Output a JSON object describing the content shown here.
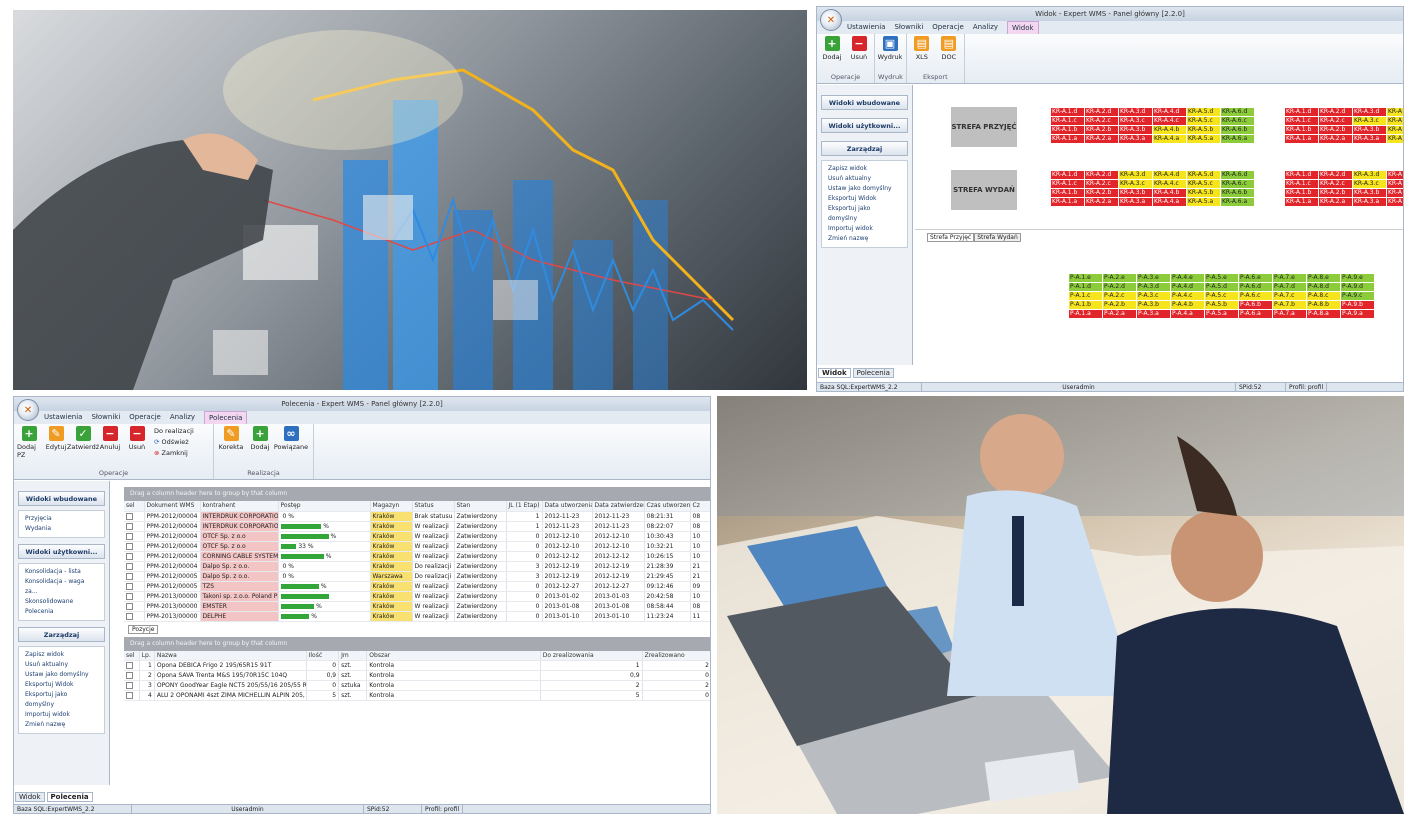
{
  "top_right": {
    "title": "Widok - Expert WMS - Panel główny [2.2.0]",
    "menu": [
      "Ustawienia",
      "Słowniki",
      "Operacje",
      "Analizy",
      "Widok"
    ],
    "ribbon": {
      "operacje": {
        "label": "Operacje",
        "buttons": [
          "Dodaj",
          "Usuń"
        ]
      },
      "wydruk": {
        "label": "Wydruk",
        "buttons": [
          "Wydruk"
        ]
      },
      "eksport": {
        "label": "Eksport",
        "buttons": [
          "XLS",
          "DOC"
        ]
      }
    },
    "sidebar": {
      "sections": [
        "Widoki wbudowane",
        "Widoki użytkowni...",
        "Zarządzaj"
      ],
      "manage": [
        "Zapisz widok",
        "Usuń aktualny",
        "Ustaw jako domyślny",
        "Eksportuj Widok",
        "Eksportuj jako domyślny",
        "Importuj widok",
        "Zmień nazwę"
      ]
    },
    "zones": [
      "STREFA PRZYJĘĆ",
      "STREFA WYDAŃ"
    ],
    "racks_a": [
      [
        "KR-A.1.d",
        "KR-A.2.d",
        "KR-A.3.d",
        "KR-A.4.d",
        "KR-A.5.d",
        "KR-A.6.d"
      ],
      [
        "KR-A.1.c",
        "KR-A.2.c",
        "KR-A.3.c",
        "KR-A.4.c",
        "KR-A.5.c",
        "KR-A.6.c"
      ],
      [
        "KR-A.1.b",
        "KR-A.2.b",
        "KR-A.3.b",
        "KR-A.4.b",
        "KR-A.5.b",
        "KR-A.6.b"
      ],
      [
        "KR-A.1.a",
        "KR-A.2.a",
        "KR-A.3.a",
        "KR-A.4.a",
        "KR-A.5.a",
        "KR-A.6.a"
      ]
    ],
    "racks_a_colors": [
      [
        "r",
        "r",
        "r",
        "r",
        "y",
        "g"
      ],
      [
        "r",
        "r",
        "r",
        "r",
        "y",
        "g"
      ],
      [
        "r",
        "r",
        "r",
        "y",
        "y",
        "g"
      ],
      [
        "r",
        "r",
        "r",
        "y",
        "y",
        "g"
      ]
    ],
    "racks_b_colors": [
      [
        "r",
        "r",
        "y",
        "y",
        "y",
        "g"
      ],
      [
        "r",
        "r",
        "y",
        "y",
        "y",
        "g"
      ],
      [
        "r",
        "r",
        "r",
        "r",
        "y",
        "g"
      ],
      [
        "r",
        "r",
        "r",
        "r",
        "y",
        "g"
      ]
    ],
    "racks_c": [
      [
        "KR-A.1.d",
        "KR-A.2.d",
        "KR-A.3.d",
        "KR-A"
      ],
      [
        "KR-A.1.c",
        "KR-A.2.c",
        "KR-A.3.c",
        "KR-A"
      ],
      [
        "KR-A.1.b",
        "KR-A.2.b",
        "KR-A.3.b",
        "KR-A"
      ],
      [
        "KR-A.1.a",
        "KR-A.2.a",
        "KR-A.3.a",
        "KR-A"
      ]
    ],
    "racks_c_colors": [
      [
        "r",
        "r",
        "r",
        "y"
      ],
      [
        "r",
        "r",
        "y",
        "y"
      ],
      [
        "r",
        "r",
        "r",
        "y"
      ],
      [
        "r",
        "r",
        "r",
        "y"
      ]
    ],
    "racks_d_colors": [
      [
        "r",
        "r",
        "y",
        "r"
      ],
      [
        "r",
        "r",
        "y",
        "r"
      ],
      [
        "r",
        "r",
        "r",
        "r"
      ],
      [
        "r",
        "r",
        "r",
        "r"
      ]
    ],
    "subtabs": [
      "Strefa Przyjęć",
      "Strefa Wydań"
    ],
    "racks_p": [
      [
        "P-A.1.e",
        "P-A.2.e",
        "P-A.3.e",
        "P-A.4.e",
        "P-A.5.e",
        "P-A.6.e",
        "P-A.7.e",
        "P-A.8.e",
        "P-A.9.e"
      ],
      [
        "P-A.1.d",
        "P-A.2.d",
        "P-A.3.d",
        "P-A.4.d",
        "P-A.5.d",
        "P-A.6.d",
        "P-A.7.d",
        "P-A.8.d",
        "P-A.9.d"
      ],
      [
        "P-A.1.c",
        "P-A.2.c",
        "P-A.3.c",
        "P-A.4.c",
        "P-A.5.c",
        "P-A.6.c",
        "P-A.7.c",
        "P-A.8.c",
        "P-A.9.c"
      ],
      [
        "P-A.1.b",
        "P-A.2.b",
        "P-A.3.b",
        "P-A.4.b",
        "P-A.5.b",
        "P-A.6.b",
        "P-A.7.b",
        "P-A.8.b",
        "P-A.9.b"
      ],
      [
        "P-A.1.a",
        "P-A.2.a",
        "P-A.3.a",
        "P-A.4.a",
        "P-A.5.a",
        "P-A.6.a",
        "P-A.7.a",
        "P-A.8.a",
        "P-A.9.a"
      ]
    ],
    "racks_p_colors": [
      [
        "g",
        "g",
        "g",
        "g",
        "g",
        "g",
        "g",
        "g",
        "g"
      ],
      [
        "g",
        "g",
        "g",
        "g",
        "g",
        "g",
        "g",
        "g",
        "g"
      ],
      [
        "y",
        "y",
        "y",
        "y",
        "y",
        "y",
        "y",
        "y",
        "g"
      ],
      [
        "y",
        "y",
        "y",
        "y",
        "y",
        "r",
        "y",
        "y",
        "r"
      ],
      [
        "r",
        "r",
        "r",
        "r",
        "r",
        "r",
        "r",
        "r",
        "r"
      ]
    ],
    "bottom_tabs": [
      "Widok",
      "Polecenia"
    ],
    "status": [
      "Baza SQL:ExpertWMS_2.2",
      "Useradmin",
      "SPid:52",
      "Profil: profil"
    ]
  },
  "bottom_left": {
    "title": "Polecenia - Expert WMS - Panel główny [2.2.0]",
    "menu": [
      "Ustawienia",
      "Słowniki",
      "Operacje",
      "Analizy",
      "Polecenia"
    ],
    "ribbon": {
      "operacje_label": "Operacje",
      "realizacja_label": "Realizacja",
      "buttons": [
        "Dodaj PZ",
        "Edytuj",
        "Zatwierdź",
        "Anuluj",
        "Usuń"
      ],
      "small": [
        "Do realizacji",
        "Odśwież",
        "Zamknij"
      ],
      "realizacja_buttons": [
        "Korekta",
        "Dodaj",
        "Powiązane"
      ]
    },
    "sidebar": {
      "sections": [
        "Widoki wbudowane",
        "Widoki użytkowni...",
        "Zarządzaj"
      ],
      "builtin": [
        "Przyjęcia",
        "Wydania"
      ],
      "user": [
        "Konsolidacja - lista",
        "Konsolidacja - waga za...",
        "Skonsolidowane",
        "Polecenia"
      ],
      "manage": [
        "Zapisz widok",
        "Usuń aktualny",
        "Ustaw jako domyślny",
        "Eksportuj Widok",
        "Eksportuj jako domyślny",
        "Importuj widok",
        "Zmień nazwę"
      ]
    },
    "drag_hint": "Drag a column header here to group by that column",
    "columns": [
      "sel",
      "Dokument WMS",
      "kontrahent",
      "Postęp",
      "Magazyn",
      "Status",
      "Stan",
      "JL (1 Etap)",
      "Data utworzenia",
      "Data zatwierdzenia",
      "Czas utworzenia",
      "Cz"
    ],
    "rows": [
      [
        "PPM-2012/00004",
        "INTERDRUK CORPORATIO",
        "0 %",
        "Kraków",
        "Brak statusu",
        "Zatwierdzony",
        "1",
        "2012-11-23",
        "2012-11-23",
        "08:21:31",
        "08"
      ],
      [
        "PPM-2012/00004",
        "INTERDRUK CORPORATIO",
        "%",
        "Kraków",
        "W realizacji",
        "Zatwierdzony",
        "1",
        "2012-11-23",
        "2012-11-23",
        "08:22:07",
        "08"
      ],
      [
        "PPM-2012/00004",
        "OTCF Sp. z o.o",
        "%",
        "Kraków",
        "W realizacji",
        "Zatwierdzony",
        "0",
        "2012-12-10",
        "2012-12-10",
        "10:30:43",
        "10"
      ],
      [
        "PPM-2012/00004",
        "OTCF Sp. z o.o",
        "33 %",
        "Kraków",
        "W realizacji",
        "Zatwierdzony",
        "0",
        "2012-12-10",
        "2012-12-10",
        "10:32:21",
        "10"
      ],
      [
        "PPM-2012/00004",
        "CORNING CABLE SYSTEMS",
        "%",
        "Kraków",
        "W realizacji",
        "Zatwierdzony",
        "0",
        "2012-12-12",
        "2012-12-12",
        "10:26:15",
        "10"
      ],
      [
        "PPM-2012/00004",
        "Dalpo Sp. z o.o.",
        "0 %",
        "Kraków",
        "Do realizacji",
        "Zatwierdzony",
        "3",
        "2012-12-19",
        "2012-12-19",
        "21:28:39",
        "21"
      ],
      [
        "PPM-2012/00005",
        "Dalpo Sp. z o.o.",
        "0 %",
        "Warszawa",
        "Do realizacji",
        "Zatwierdzony",
        "3",
        "2012-12-19",
        "2012-12-19",
        "21:29:45",
        "21"
      ],
      [
        "PPM-2012/00005",
        "TZS",
        "%",
        "Kraków",
        "W realizacji",
        "Zatwierdzony",
        "0",
        "2012-12-27",
        "2012-12-27",
        "09:12:46",
        "09"
      ],
      [
        "PPM-2013/00000",
        "Takoni sp. z.o.o. Poland PE",
        "",
        "Kraków",
        "W realizacji",
        "Zatwierdzony",
        "0",
        "2013-01-02",
        "2013-01-03",
        "20:42:58",
        "10"
      ],
      [
        "PPM-2013/00000",
        "EMSTER",
        "%",
        "Kraków",
        "W realizacji",
        "Zatwierdzony",
        "0",
        "2013-01-08",
        "2013-01-08",
        "08:58:44",
        "08"
      ],
      [
        "PPM-2013/00000",
        "DELPHE",
        "%",
        "Kraków",
        "W realizacji",
        "Zatwierdzony",
        "0",
        "2013-01-10",
        "2013-01-10",
        "11:23:24",
        "11"
      ]
    ],
    "progress": [
      0,
      0.85,
      1,
      0.33,
      0.9,
      0,
      0,
      0.8,
      1,
      0.7,
      0.6
    ],
    "pos_tab": "Pozycje",
    "pos_columns": [
      "sel",
      "Lp.",
      "Nazwa",
      "Ilość",
      "Jm",
      "Obszar",
      "Do zrealizowania",
      "Zrealizowano"
    ],
    "pos_rows": [
      [
        "1",
        "Opona DEBICA Frigo 2 195/65R15 91T",
        "0",
        "szt.",
        "Kontrola",
        "1",
        "2"
      ],
      [
        "2",
        "Opona SAVA Trenta M&S 195/70R15C 104Q",
        "0,9",
        "szt.",
        "Kontrola",
        "0,9",
        "0"
      ],
      [
        "3",
        "OPONY GoodYear Eagle NCT5 205/55/16 205/55 R",
        "0",
        "sztuka",
        "Kontrola",
        "2",
        "2"
      ],
      [
        "4",
        "ALU 2 OPONAMI 4szt ZIMA MICHELLIN ALPIN 205,",
        "5",
        "szt.",
        "Kontrola",
        "5",
        "0"
      ]
    ],
    "bottom_tabs": [
      "Widok",
      "Polecenia"
    ],
    "status": [
      "Baza SQL:ExpertWMS_2.2",
      "Useradmin",
      "SPid:52",
      "Profil: profil"
    ]
  }
}
